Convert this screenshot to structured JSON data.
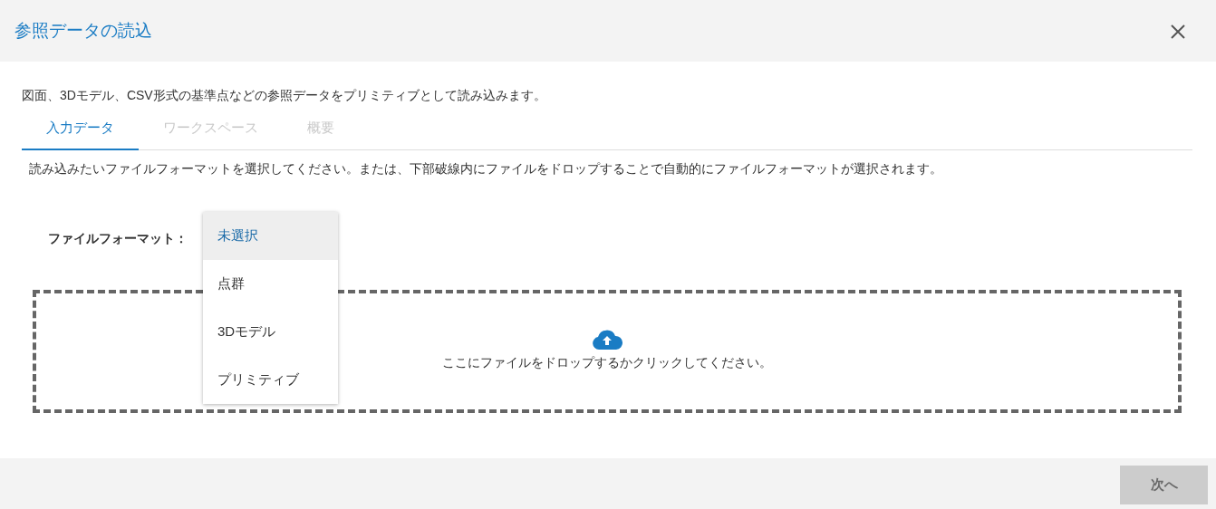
{
  "window": {
    "title": "参照データの読込"
  },
  "description": "図面、3Dモデル、CSV形式の基準点などの参照データをプリミティブとして読み込みます。",
  "tabs": [
    {
      "label": "入力データ",
      "selected": true,
      "disabled": false
    },
    {
      "label": "ワークスペース",
      "selected": false,
      "disabled": true
    },
    {
      "label": "概要",
      "selected": false,
      "disabled": true
    }
  ],
  "instruction": "読み込みたいファイルフォーマットを選択してください。または、下部破線内にファイルをドロップすることで自動的にファイルフォーマットが選択されます。",
  "format": {
    "label": "ファイルフォーマット：",
    "options": [
      {
        "label": "未選択",
        "selected": true
      },
      {
        "label": "点群",
        "selected": false
      },
      {
        "label": "3Dモデル",
        "selected": false
      },
      {
        "label": "プリミティブ",
        "selected": false
      }
    ]
  },
  "dropzone": {
    "text": "ここにファイルをドロップするかクリックしてください。"
  },
  "buttons": [
    {
      "label": "次へ",
      "disabled": true
    }
  ]
}
